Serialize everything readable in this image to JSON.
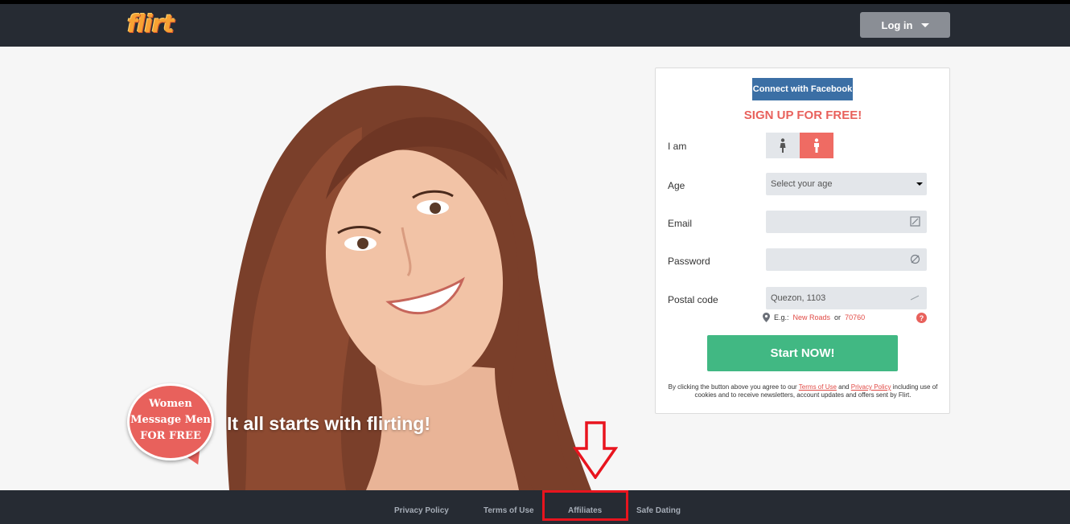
{
  "header": {
    "logo_text": "flirt",
    "login_label": "Log in"
  },
  "hero": {
    "tagline": "It all starts with flirting!",
    "bubble": [
      "Women",
      "Message Men",
      "FOR FREE"
    ]
  },
  "signup": {
    "facebook_label": "Connect with Facebook",
    "title": "SIGN UP FOR FREE!",
    "iam_label": "I am",
    "age_label": "Age",
    "age_placeholder": "Select your age",
    "email_label": "Email",
    "email_value": "",
    "password_label": "Password",
    "password_value": "",
    "postal_label": "Postal code",
    "postal_value": "Quezon, 1103",
    "hint_prefix": "E.g.:",
    "hint_example1": "New Roads",
    "hint_or": "or",
    "hint_example2": "70760",
    "help_glyph": "?",
    "start_label": "Start NOW!",
    "legal_1": "By clicking the button above you agree to our",
    "terms_link": "Terms of Use",
    "legal_and": "and",
    "privacy_link": "Privacy Policy",
    "legal_2": "including use of cookies and to receive newsletters, account updates and offers sent by Flirt."
  },
  "footer": {
    "links": [
      "Privacy Policy",
      "Terms of Use",
      "Affiliates",
      "Safe Dating"
    ]
  },
  "colors": {
    "header_bg": "#262b33",
    "accent_red": "#e8615c",
    "start_green": "#41b883",
    "facebook_blue": "#3b6fa5",
    "annotation_red": "#e8141e"
  },
  "icons": {
    "login_caret": "caret-down-icon",
    "female": "female-icon",
    "male": "male-icon",
    "email": "email-field-icon",
    "password": "password-field-icon",
    "postal": "location-pin-icon",
    "help": "help-icon",
    "annotation": "down-arrow-icon"
  }
}
